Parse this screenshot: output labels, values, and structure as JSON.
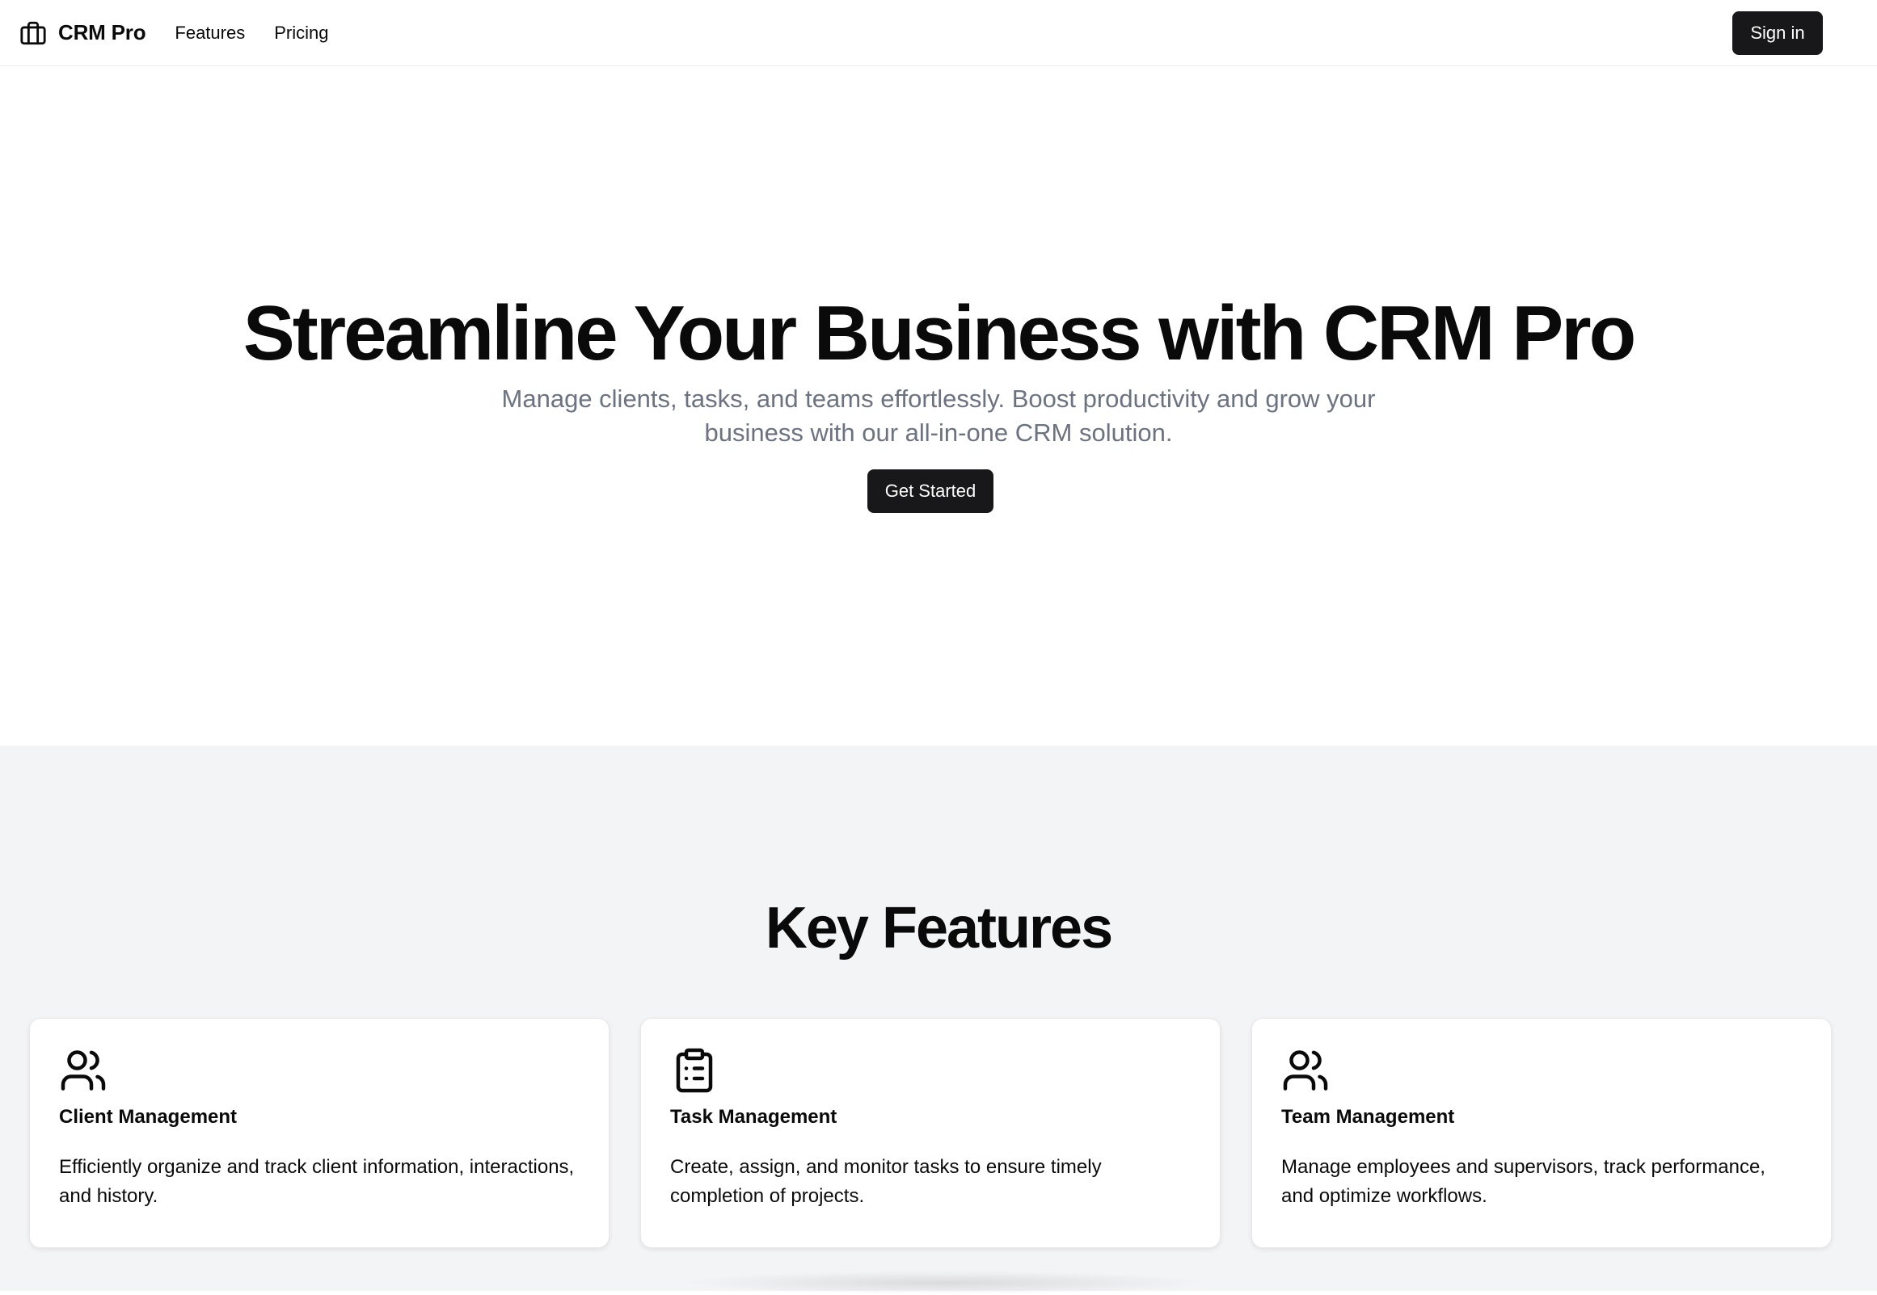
{
  "nav": {
    "brand": "CRM Pro",
    "brand_icon": "briefcase-icon",
    "links": [
      {
        "label": "Features"
      },
      {
        "label": "Pricing"
      }
    ],
    "signin_label": "Sign in"
  },
  "hero": {
    "title": "Streamline Your Business with CRM Pro",
    "subtitle": "Manage clients, tasks, and teams effortlessly. Boost productivity and grow your business with our all-in-one CRM solution.",
    "cta_label": "Get Started"
  },
  "features": {
    "title": "Key Features",
    "cards": [
      {
        "icon": "users-icon",
        "title": "Client Management",
        "description": "Efficiently organize and track client information, interactions, and history."
      },
      {
        "icon": "clipboard-list-icon",
        "title": "Task Management",
        "description": "Create, assign, and monitor tasks to ensure timely completion of projects."
      },
      {
        "icon": "users-icon",
        "title": "Team Management",
        "description": "Manage employees and supervisors, track performance, and optimize workflows."
      }
    ]
  },
  "colors": {
    "primary_button": "#18181b",
    "muted_text": "#6b7280",
    "section_bg": "#f3f4f6"
  }
}
